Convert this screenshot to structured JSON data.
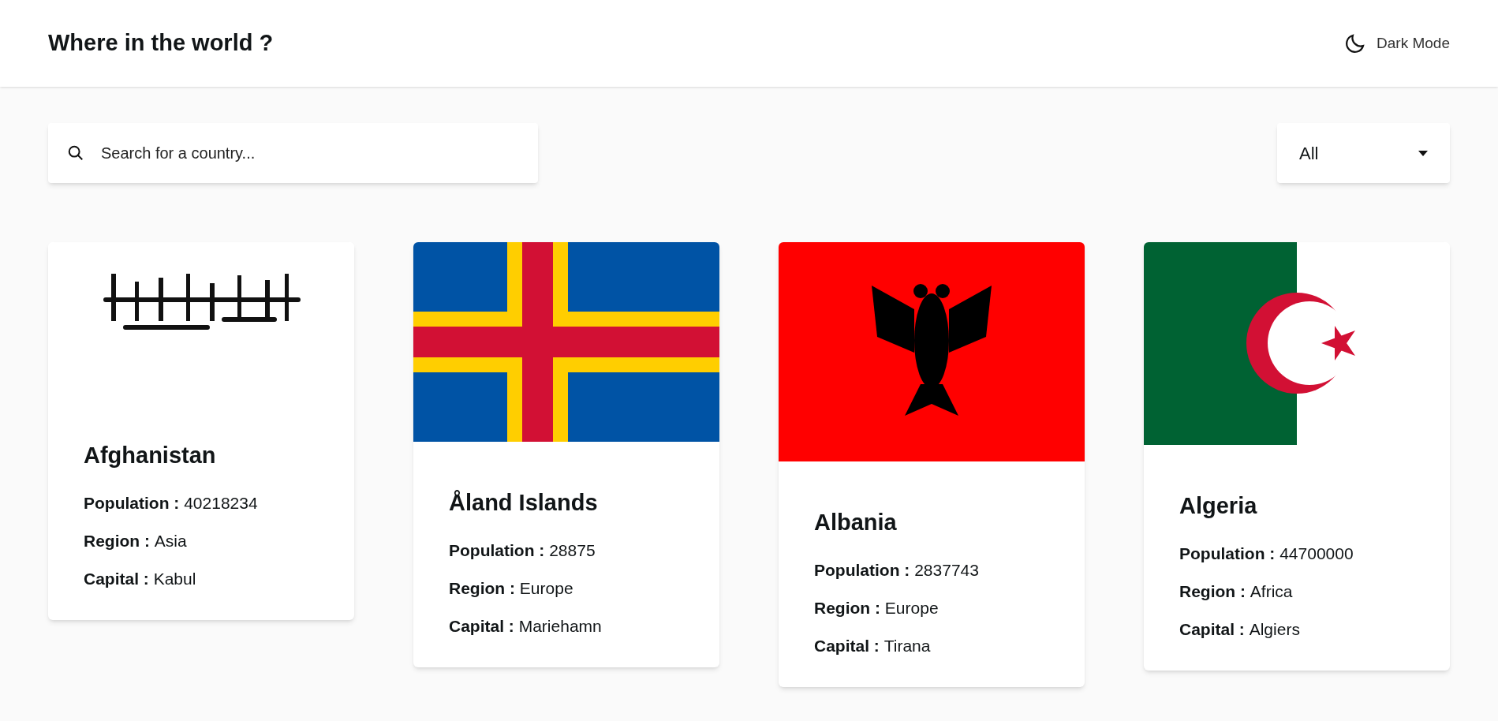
{
  "header": {
    "title": "Where in the world ?",
    "theme_toggle": "Dark Mode"
  },
  "search": {
    "placeholder": "Search for a country..."
  },
  "region_filter": {
    "value": "All"
  },
  "countries": [
    {
      "name": "Afghanistan",
      "fields": [
        {
          "label": "Population :",
          "value": "40218234"
        },
        {
          "label": "Region :",
          "value": "Asia"
        },
        {
          "label": "Capital :",
          "value": "Kabul"
        }
      ]
    },
    {
      "name": "Åland Islands",
      "fields": [
        {
          "label": "Population :",
          "value": "28875"
        },
        {
          "label": "Region :",
          "value": "Europe"
        },
        {
          "label": "Capital :",
          "value": "Mariehamn"
        }
      ]
    },
    {
      "name": "Albania",
      "fields": [
        {
          "label": "Population :",
          "value": "2837743"
        },
        {
          "label": "Region :",
          "value": "Europe"
        },
        {
          "label": "Capital :",
          "value": "Tirana"
        }
      ]
    },
    {
      "name": "Algeria",
      "fields": [
        {
          "label": "Population :",
          "value": "44700000"
        },
        {
          "label": "Region :",
          "value": "Africa"
        },
        {
          "label": "Capital :",
          "value": "Algiers"
        }
      ]
    }
  ]
}
